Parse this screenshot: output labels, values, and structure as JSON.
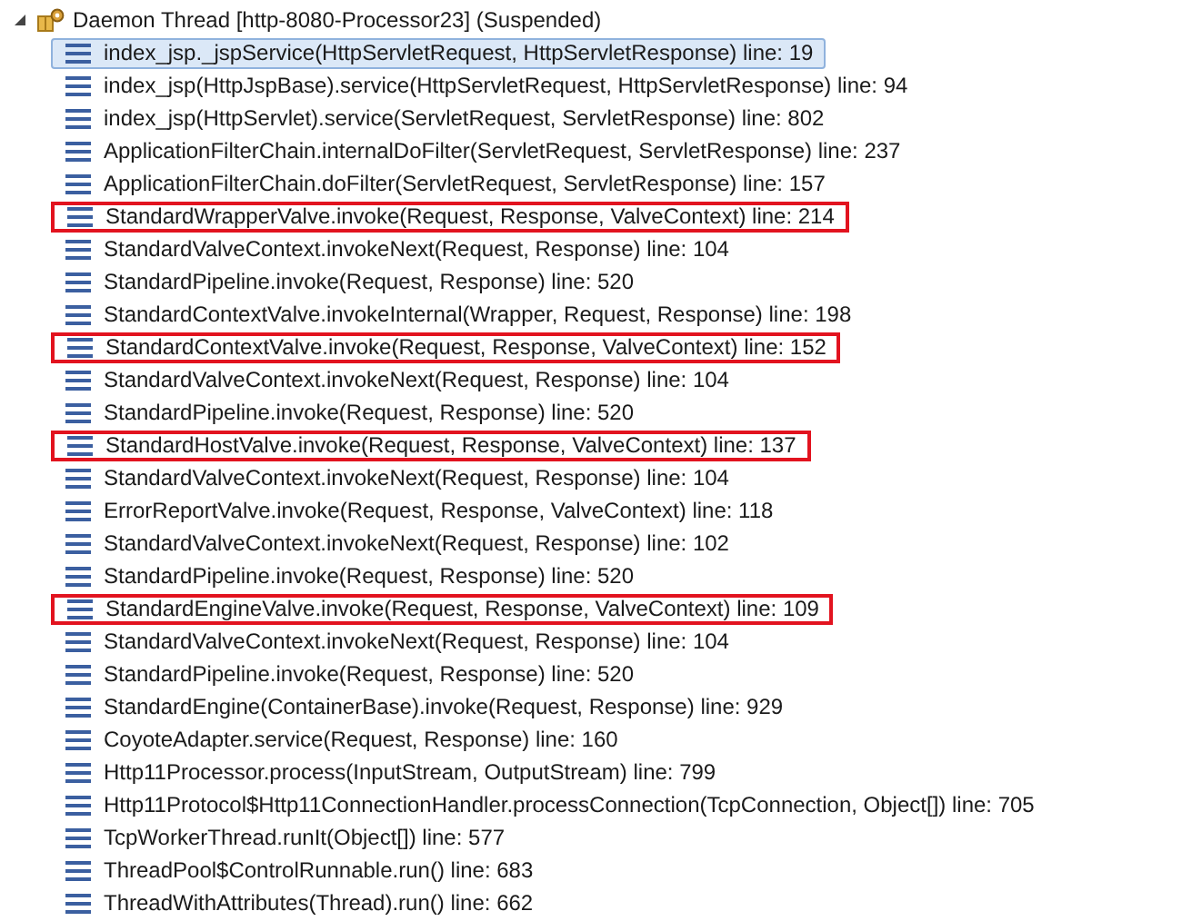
{
  "thread": {
    "label": "Daemon Thread [http-8080-Processor23] (Suspended)",
    "expanded": true
  },
  "frames": [
    {
      "label": "index_jsp._jspService(HttpServletRequest, HttpServletResponse) line: 19",
      "selected": true,
      "highlighted": false
    },
    {
      "label": "index_jsp(HttpJspBase).service(HttpServletRequest, HttpServletResponse) line: 94",
      "selected": false,
      "highlighted": false
    },
    {
      "label": "index_jsp(HttpServlet).service(ServletRequest, ServletResponse) line: 802",
      "selected": false,
      "highlighted": false
    },
    {
      "label": "ApplicationFilterChain.internalDoFilter(ServletRequest, ServletResponse) line: 237",
      "selected": false,
      "highlighted": false
    },
    {
      "label": "ApplicationFilterChain.doFilter(ServletRequest, ServletResponse) line: 157",
      "selected": false,
      "highlighted": false
    },
    {
      "label": "StandardWrapperValve.invoke(Request, Response, ValveContext) line: 214",
      "selected": false,
      "highlighted": true
    },
    {
      "label": "StandardValveContext.invokeNext(Request, Response) line: 104",
      "selected": false,
      "highlighted": false
    },
    {
      "label": "StandardPipeline.invoke(Request, Response) line: 520",
      "selected": false,
      "highlighted": false
    },
    {
      "label": "StandardContextValve.invokeInternal(Wrapper, Request, Response) line: 198",
      "selected": false,
      "highlighted": false
    },
    {
      "label": "StandardContextValve.invoke(Request, Response, ValveContext) line: 152",
      "selected": false,
      "highlighted": true
    },
    {
      "label": "StandardValveContext.invokeNext(Request, Response) line: 104",
      "selected": false,
      "highlighted": false
    },
    {
      "label": "StandardPipeline.invoke(Request, Response) line: 520",
      "selected": false,
      "highlighted": false
    },
    {
      "label": "StandardHostValve.invoke(Request, Response, ValveContext) line: 137",
      "selected": false,
      "highlighted": true
    },
    {
      "label": "StandardValveContext.invokeNext(Request, Response) line: 104",
      "selected": false,
      "highlighted": false
    },
    {
      "label": "ErrorReportValve.invoke(Request, Response, ValveContext) line: 118",
      "selected": false,
      "highlighted": false
    },
    {
      "label": "StandardValveContext.invokeNext(Request, Response) line: 102",
      "selected": false,
      "highlighted": false
    },
    {
      "label": "StandardPipeline.invoke(Request, Response) line: 520",
      "selected": false,
      "highlighted": false
    },
    {
      "label": "StandardEngineValve.invoke(Request, Response, ValveContext) line: 109",
      "selected": false,
      "highlighted": true
    },
    {
      "label": "StandardValveContext.invokeNext(Request, Response) line: 104",
      "selected": false,
      "highlighted": false
    },
    {
      "label": "StandardPipeline.invoke(Request, Response) line: 520",
      "selected": false,
      "highlighted": false
    },
    {
      "label": "StandardEngine(ContainerBase).invoke(Request, Response) line: 929",
      "selected": false,
      "highlighted": false
    },
    {
      "label": "CoyoteAdapter.service(Request, Response) line: 160",
      "selected": false,
      "highlighted": false
    },
    {
      "label": "Http11Processor.process(InputStream, OutputStream) line: 799",
      "selected": false,
      "highlighted": false
    },
    {
      "label": "Http11Protocol$Http11ConnectionHandler.processConnection(TcpConnection, Object[]) line: 705",
      "selected": false,
      "highlighted": false
    },
    {
      "label": "TcpWorkerThread.runIt(Object[]) line: 577",
      "selected": false,
      "highlighted": false
    },
    {
      "label": "ThreadPool$ControlRunnable.run() line: 683",
      "selected": false,
      "highlighted": false
    },
    {
      "label": "ThreadWithAttributes(Thread).run() line: 662",
      "selected": false,
      "highlighted": false
    }
  ]
}
